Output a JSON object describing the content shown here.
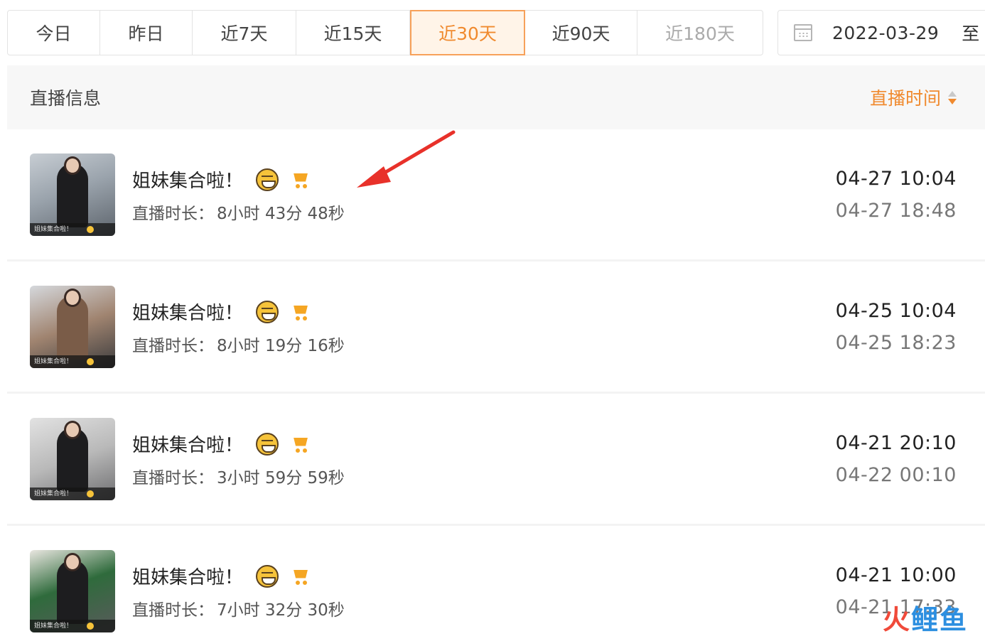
{
  "filters": {
    "tabs": [
      {
        "label": "今日",
        "active": false
      },
      {
        "label": "昨日",
        "active": false
      },
      {
        "label": "近7天",
        "active": false
      },
      {
        "label": "近15天",
        "active": false
      },
      {
        "label": "近30天",
        "active": true
      },
      {
        "label": "近90天",
        "active": false
      },
      {
        "label": "近180天",
        "active": false
      }
    ],
    "date_start": "2022-03-29",
    "date_separator": "至"
  },
  "table": {
    "header_title": "直播信息",
    "header_sort_label": "直播时间",
    "duration_label": "直播时长：",
    "rows": [
      {
        "title": "姐妹集合啦！",
        "duration": "8小时 43分 48秒",
        "start": "04-27 10:04",
        "end": "04-27 18:48",
        "thumb_caption": "姐妹集合啦！"
      },
      {
        "title": "姐妹集合啦！",
        "duration": "8小时 19分 16秒",
        "start": "04-25 10:04",
        "end": "04-25 18:23",
        "thumb_caption": "姐妹集合啦！"
      },
      {
        "title": "姐妹集合啦！",
        "duration": "3小时 59分 59秒",
        "start": "04-21 20:10",
        "end": "04-22 00:10",
        "thumb_caption": "姐妹集合啦！"
      },
      {
        "title": "姐妹集合啦！",
        "duration": "7小时 32分 30秒",
        "start": "04-21 10:00",
        "end": "04-21 17:33",
        "thumb_caption": "姐妹集合啦！"
      }
    ]
  },
  "watermark": {
    "part1": "火",
    "part2": "鲤鱼"
  },
  "colors": {
    "accent": "#f08a2e",
    "active_bg": "#fff4e8",
    "cart": "#f5a623",
    "arrow": "#e8312a"
  }
}
